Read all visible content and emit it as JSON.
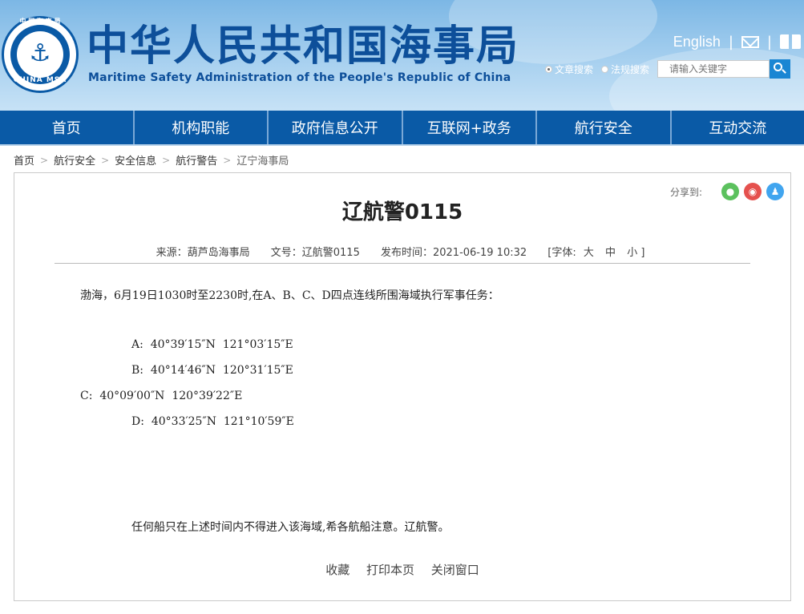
{
  "header": {
    "logo": {
      "top_text": "中 国 海 事 局",
      "bottom_text": "CHINA MSA",
      "icon": "anchor-icon"
    },
    "site_title": "中华人民共和国海事局",
    "site_subtitle": "Maritime Safety Administration of the People's Republic of China",
    "english_link": "English",
    "icons": [
      "mail-icon",
      "book-icon"
    ],
    "search": {
      "radio_article": "文章搜索",
      "radio_law": "法规搜索",
      "placeholder": "请输入关键字",
      "icon": "search-icon"
    },
    "colors": {
      "header_bg": "#a7d0ef",
      "title": "#0d4f9a"
    }
  },
  "nav": {
    "items": [
      "首页",
      "机构职能",
      "政府信息公开",
      "互联网+政务",
      "航行安全",
      "互动交流"
    ],
    "color": "#0a5aa6"
  },
  "breadcrumb": [
    "首页",
    "航行安全",
    "安全信息",
    "航行警告",
    "辽宁海事局"
  ],
  "article": {
    "share_label": "分享到:",
    "share_icons": [
      "wechat-icon",
      "weibo-icon",
      "qq-icon"
    ],
    "title": "辽航警0115",
    "meta": {
      "source": "来源：葫芦岛海事局",
      "doc_no": "文号：辽航警0115",
      "published": "发布时间：2021-06-19 10:32",
      "font_label": "[字体:",
      "font_large": "大",
      "font_medium": "中",
      "font_small": "小 ]"
    },
    "paragraphs": {
      "intro": "渤海，6月19日1030时至2230时,在A、B、C、D四点连线所围海域执行军事任务：",
      "point_a": "A:  40°39′15″N  121°03′15″E",
      "point_b": "B:  40°14′46″N  120°31′15″E",
      "point_c": "C:  40°09′00″N  120°39′22″E",
      "point_d": "D:  40°33′25″N  121°10′59″E",
      "notice": "任何船只在上述时间内不得进入该海域,希各航船注意。辽航警。"
    },
    "actions": {
      "favorite": "收藏",
      "print": "打印本页",
      "close": "关闭窗口"
    }
  }
}
